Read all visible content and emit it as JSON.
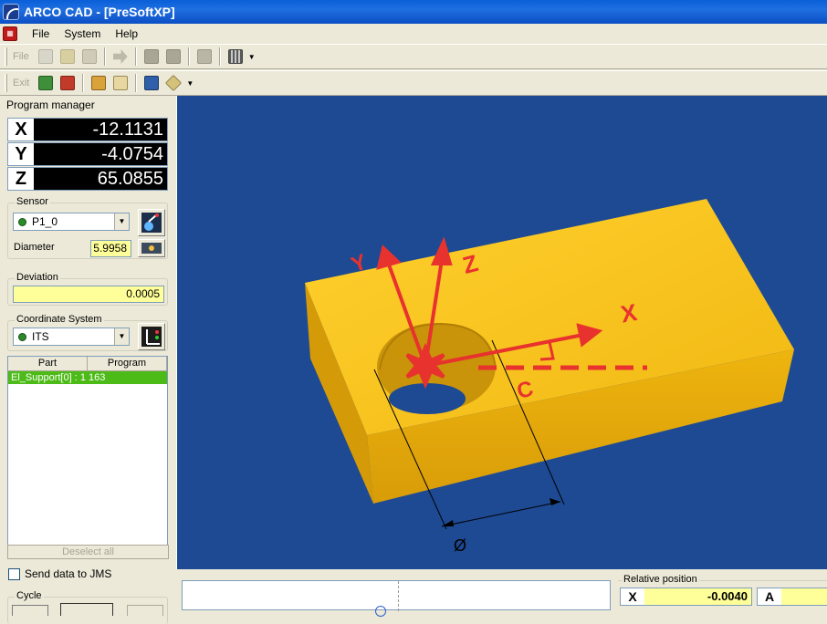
{
  "window": {
    "title": "ARCO CAD - [PreSoftXP]"
  },
  "menu": {
    "items": [
      "File",
      "System",
      "Help"
    ]
  },
  "toolbar1": {
    "file_label": "File"
  },
  "toolbar2": {
    "exit_label": "Exit"
  },
  "program_manager": {
    "title": "Program manager",
    "coords": [
      {
        "axis": "X",
        "value": "-12.1131"
      },
      {
        "axis": "Y",
        "value": "-4.0754"
      },
      {
        "axis": "Z",
        "value": "65.0855"
      }
    ]
  },
  "sensor": {
    "label": "Sensor",
    "selected": "P1_0",
    "diameter_label": "Diameter",
    "diameter_value": "5.9958"
  },
  "deviation": {
    "label": "Deviation",
    "value": "0.0005"
  },
  "coordinate_system": {
    "label": "Coordinate System",
    "selected": "ITS"
  },
  "part_list": {
    "columns": [
      "Part",
      "Program"
    ],
    "rows": [
      {
        "text": "El_Support[0] : 1 163"
      }
    ]
  },
  "deselect_all_label": "Deselect all",
  "send_data_label": "Send data to JMS",
  "cycle_label": "Cycle",
  "viewport": {
    "axis_labels": {
      "x": "X",
      "y": "Y",
      "z": "Z",
      "c": "C"
    },
    "diameter_symbol": "Ø"
  },
  "relative_position": {
    "label": "Relative position",
    "x_axis": "X",
    "x_value": "-0.0040",
    "a_axis": "A"
  },
  "colors": {
    "viewport_bg": "#1d4a93",
    "part": "#f6c21c",
    "axes": "#e8322e",
    "selected_row": "#4cbb17"
  }
}
